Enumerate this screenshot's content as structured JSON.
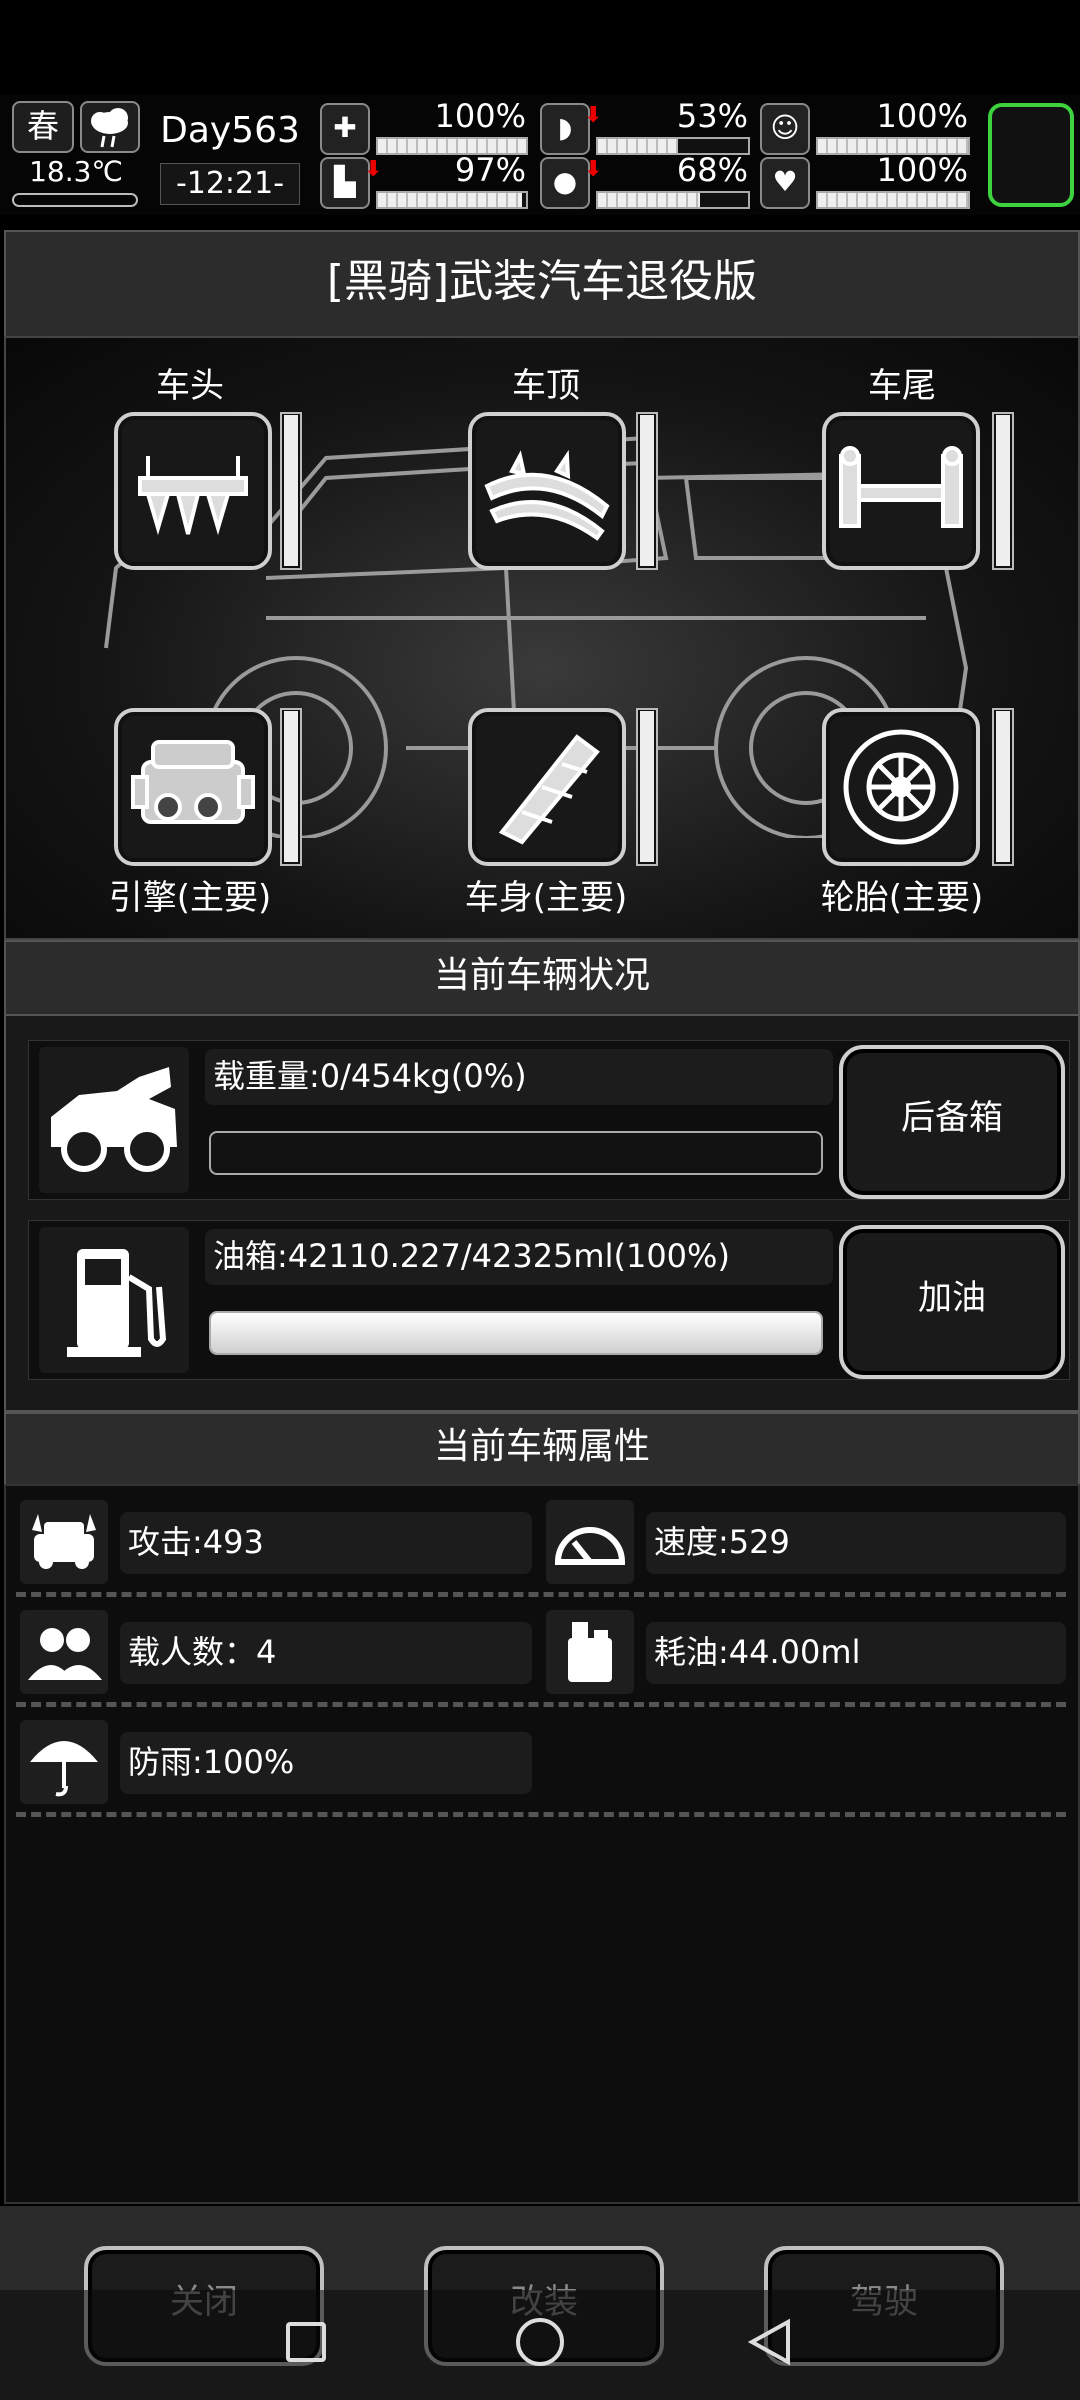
{
  "status": {
    "season": "春",
    "temperature": "18.3℃",
    "day": "Day563",
    "time": "-12:21-",
    "stats": [
      {
        "name": "health",
        "value": "100%",
        "level": 1.0,
        "down": false,
        "icon": "medkit-icon"
      },
      {
        "name": "hunger",
        "value": "53%",
        "level": 0.53,
        "down": true,
        "icon": "stomach-icon"
      },
      {
        "name": "mood",
        "value": "100%",
        "level": 1.0,
        "down": false,
        "icon": "head-icon"
      },
      {
        "name": "stamina",
        "value": "97%",
        "level": 0.97,
        "down": true,
        "icon": "foot-icon"
      },
      {
        "name": "thirst",
        "value": "68%",
        "level": 0.68,
        "down": true,
        "icon": "water-drop-icon"
      },
      {
        "name": "heart",
        "value": "100%",
        "level": 1.0,
        "down": false,
        "icon": "heart-icon"
      }
    ]
  },
  "title": "[黑骑]武装汽车退役版",
  "slots": {
    "front": "车头",
    "roof": "车顶",
    "rear": "车尾",
    "engine": "引擎(主要)",
    "body": "车身(主要)",
    "tire": "轮胎(主要)"
  },
  "vehicle_status": {
    "header": "当前车辆状况",
    "load_label": "载重量:0/454kg(0%)",
    "load_level": 0.0,
    "trunk_button": "后备箱",
    "fuel_label": "油箱:42110.227/42325ml(100%)",
    "fuel_level": 1.0,
    "refuel_button": "加油"
  },
  "vehicle_attributes": {
    "header": "当前车辆属性",
    "attack": "攻击:493",
    "speed": "速度:529",
    "seats": "载人数：4",
    "fuel_use": "耗油:44.00ml",
    "rainproof": "防雨:100%"
  },
  "footer": {
    "close": "关闭",
    "modify": "改装",
    "drive": "驾驶"
  }
}
